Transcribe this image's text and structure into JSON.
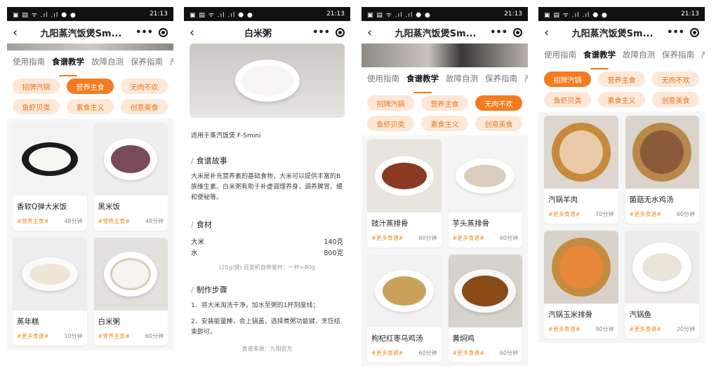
{
  "status": {
    "time": "21:13",
    "left": "▣ ▤ ᯤ .ıl .ıl ⬣ ●",
    "right": "▥ ▣"
  },
  "screen1": {
    "title": "九阳蒸汽饭煲Sm...",
    "tabs": [
      "使用指南",
      "食谱教学",
      "故障自测",
      "保养指南",
      "产品"
    ],
    "active_tab": 1,
    "chips": [
      "招牌汽锅",
      "营养主食",
      "无肉不欢",
      "鱼虾贝类",
      "素食主义",
      "创意美食"
    ],
    "active_chip": 1,
    "cards": [
      {
        "name": "香软Q弹大米饭",
        "tag": "#营养主食#",
        "time": "48分钟"
      },
      {
        "name": "黑米饭",
        "tag": "#营养主食#",
        "time": "48分钟"
      },
      {
        "name": "蒸年糕",
        "tag": "#更多食谱#",
        "time": "10分钟"
      },
      {
        "name": "白米粥",
        "tag": "#营养主食#",
        "time": "60分钟"
      }
    ]
  },
  "screen2": {
    "title": "白米粥",
    "applies": "适用于蒸汽饭煲 F-Smini",
    "story_title": "食谱故事",
    "story": "大米是补充营养素的基础食物，大米可以提供丰富的B族维生素。白米粥有助于补虚调理养身，调养脾胃、缓和便秘等。",
    "ingredients_title": "食材",
    "ingredients": [
      {
        "name": "大米",
        "amount": "140克"
      },
      {
        "name": "水",
        "amount": "800克"
      }
    ],
    "ingredient_note": "(20g/袋) 豆浆机自带量杯：一杯≈80g",
    "steps_title": "制作步骤",
    "steps": [
      "1、将大米淘洗干净，加水至粥的1杯刻度线；",
      "2、安装能量棒，合上锅盖，选择煮粥功能键，烹饪结束即可。"
    ],
    "source": "食谱来源：九阳官方"
  },
  "screen3": {
    "title": "九阳蒸汽饭煲Sm...",
    "tabs": [
      "使用指南",
      "食谱教学",
      "故障自测",
      "保养指南",
      "产品"
    ],
    "active_tab": 1,
    "chips": [
      "招牌汽锅",
      "营养主食",
      "无肉不欢",
      "鱼虾贝类",
      "素食主义",
      "创意美食"
    ],
    "active_chip": 2,
    "cards": [
      {
        "name": "豉汁蒸排骨",
        "tag": "#更多食谱#",
        "time": "60分钟"
      },
      {
        "name": "芋头蒸排骨",
        "tag": "#更多食谱#",
        "time": "60分钟"
      },
      {
        "name": "枸杞红枣乌鸡汤",
        "tag": "#更多食谱#",
        "time": "60分钟"
      },
      {
        "name": "黄焖鸡",
        "tag": "#更多食谱#",
        "time": "60分钟"
      }
    ]
  },
  "screen4": {
    "title": "九阳蒸汽饭煲Sm...",
    "tabs": [
      "使用指南",
      "食谱教学",
      "故障自测",
      "保养指南",
      "产品"
    ],
    "active_tab": 1,
    "chips": [
      "招牌汽锅",
      "营养主食",
      "无肉不欢",
      "鱼虾贝类",
      "素食主义",
      "创意美食"
    ],
    "active_chip": 0,
    "cards": [
      {
        "name": "汽锅羊肉",
        "tag": "#更多食谱#",
        "time": "70分钟"
      },
      {
        "name": "菌菇无水鸡汤",
        "tag": "#更多食谱#",
        "time": "60分钟"
      },
      {
        "name": "汽锅玉米排骨",
        "tag": "#更多食谱#",
        "time": "90分钟"
      },
      {
        "name": "汽锅鱼",
        "tag": "#更多食谱#",
        "time": "20分钟"
      }
    ]
  },
  "colors": {
    "accent": "#f47b20",
    "chip_bg": "#fde7d6",
    "tag": "#f0902a"
  },
  "icons": {
    "back": "back-arrow-icon",
    "more": "more-dots-icon",
    "record": "record-icon"
  }
}
